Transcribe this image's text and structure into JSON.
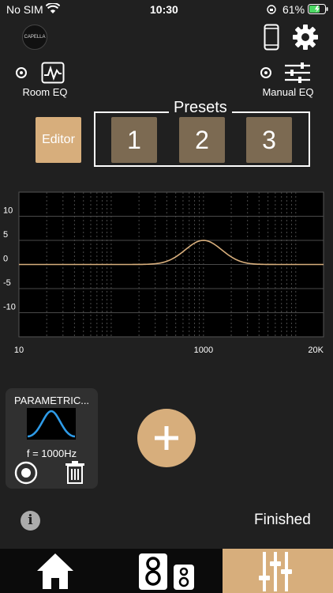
{
  "status": {
    "carrier": "No SIM",
    "time": "10:30",
    "battery": "61%"
  },
  "header": {
    "logo_text": "CAPELLA"
  },
  "modes": {
    "room_eq_label": "Room EQ",
    "manual_eq_label": "Manual EQ"
  },
  "presets": {
    "title": "Presets",
    "editor_label": "Editor",
    "items": [
      "1",
      "2",
      "3"
    ]
  },
  "chart_data": {
    "type": "line",
    "yticks": [
      "10",
      "5",
      "0",
      "-5",
      "-10"
    ],
    "xticks": [
      "10",
      "1000",
      "20K"
    ],
    "xscale": "log",
    "xlim": [
      10,
      20000
    ],
    "ylim": [
      -15,
      15
    ],
    "grid": true,
    "series": [
      {
        "peak_hz": 1000,
        "peak_db": 5,
        "color": "#d7ae7c"
      }
    ]
  },
  "filter_card": {
    "title": "PARAMETRIC...",
    "freq_label": "f = 1000Hz"
  },
  "footer": {
    "finished_label": "Finished",
    "info_symbol": "i"
  },
  "colors": {
    "accent": "#d7ae7c",
    "preset": "#7c6a52",
    "curve_blue": "#2e9be8"
  }
}
